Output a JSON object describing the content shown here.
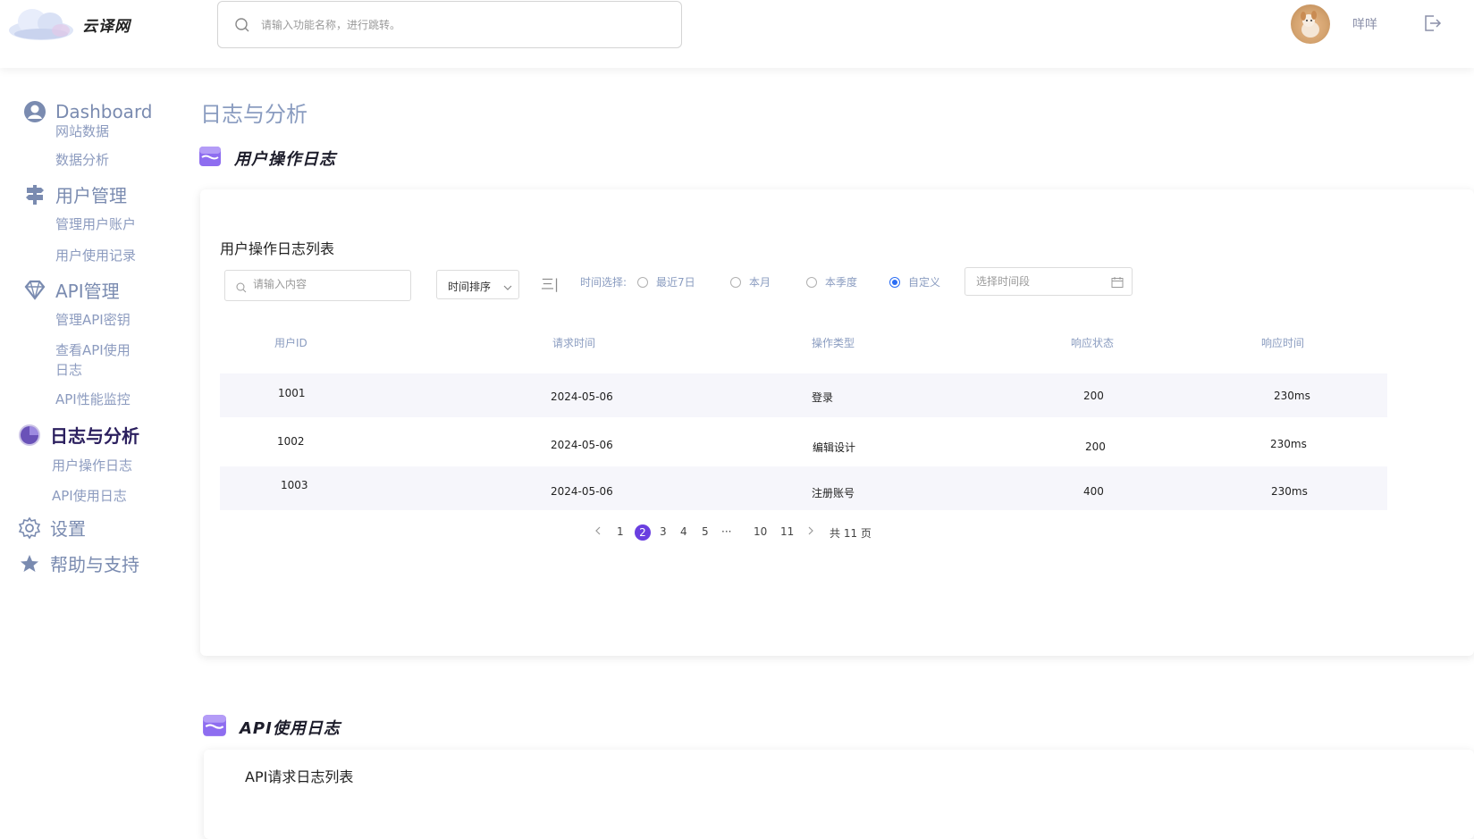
{
  "header": {
    "brand": "云译网",
    "search_placeholder": "请输入功能名称，进行跳转。",
    "username": "咩咩"
  },
  "sidebar": {
    "groups": [
      {
        "label": "Dashboard",
        "icon": "user-circle-icon",
        "items": [
          "网站数据",
          "数据分析"
        ]
      },
      {
        "label": "用户管理",
        "icon": "signpost-icon",
        "items": [
          "管理用户账户",
          "用户使用记录"
        ]
      },
      {
        "label": "API管理",
        "icon": "diamond-icon",
        "items": [
          "管理API密钥",
          "查看API使用日志",
          "API性能监控"
        ]
      },
      {
        "label": "日志与分析",
        "icon": "pie-chart-icon",
        "items": [
          "用户操作日志",
          "API使用日志"
        ],
        "active": true
      },
      {
        "label": "设置",
        "icon": "gear-icon",
        "items": []
      },
      {
        "label": "帮助与支持",
        "icon": "star-icon",
        "items": []
      }
    ],
    "sub_api_log_line1": "查看API使用",
    "sub_api_log_line2": "日志"
  },
  "main": {
    "page_title": "日志与分析",
    "section1": {
      "title": "用户操作日志",
      "card_title": "用户操作日志列表",
      "search_placeholder": "请输入内容",
      "sort_label": "时间排序",
      "filter_label": "时间选择:",
      "radios": [
        "最近7日",
        "本月",
        "本季度",
        "自定义"
      ],
      "selected_radio": "自定义",
      "date_placeholder": "选择时间段",
      "columns": [
        "用户ID",
        "请求时间",
        "操作类型",
        "响应状态",
        "响应时间"
      ],
      "rows": [
        [
          "1001",
          "2024-05-06",
          "登录",
          "200",
          "230ms"
        ],
        [
          "1002",
          "2024-05-06",
          "编辑设计",
          "200",
          "230ms"
        ],
        [
          "1003",
          "2024-05-06",
          "注册账号",
          "400",
          "230ms"
        ]
      ],
      "pagination": {
        "pages": [
          "1",
          "2",
          "3",
          "4",
          "5",
          "···",
          "10",
          "11"
        ],
        "current": "2",
        "total": "共 11 页"
      }
    },
    "section2": {
      "title": "API使用日志",
      "card_title": "API请求日志列表"
    }
  },
  "colors": {
    "accent": "#6a3fe0",
    "nav_text": "#7a8bb0",
    "radio_checked": "#2a6df4"
  }
}
